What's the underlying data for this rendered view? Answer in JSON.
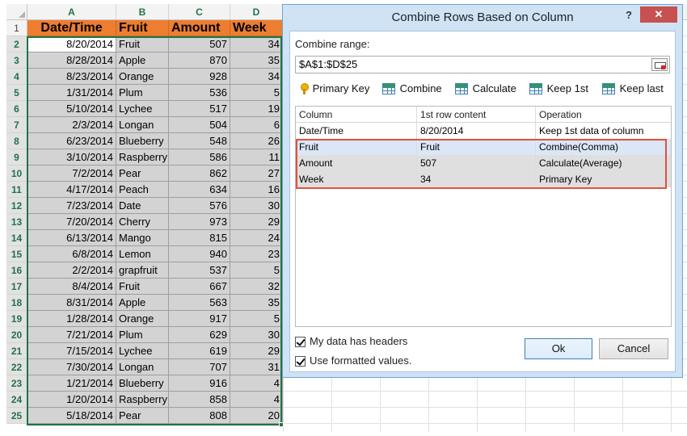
{
  "sheet": {
    "columns": [
      "A",
      "B",
      "C",
      "D"
    ],
    "header_row": [
      "Date/Time",
      "Fruit",
      "Amount",
      "Week"
    ],
    "rows": [
      [
        "8/20/2014",
        "Fruit",
        "507",
        "34"
      ],
      [
        "8/28/2014",
        "Apple",
        "870",
        "35"
      ],
      [
        "8/23/2014",
        "Orange",
        "928",
        "34"
      ],
      [
        "1/31/2014",
        "Plum",
        "536",
        "5"
      ],
      [
        "5/10/2014",
        "Lychee",
        "517",
        "19"
      ],
      [
        "2/3/2014",
        "Longan",
        "504",
        "6"
      ],
      [
        "6/23/2014",
        "Blueberry",
        "548",
        "26"
      ],
      [
        "3/10/2014",
        "Raspberry",
        "586",
        "11"
      ],
      [
        "7/2/2014",
        "Pear",
        "862",
        "27"
      ],
      [
        "4/17/2014",
        "Peach",
        "634",
        "16"
      ],
      [
        "7/23/2014",
        "Date",
        "576",
        "30"
      ],
      [
        "7/20/2014",
        "Cherry",
        "973",
        "29"
      ],
      [
        "6/13/2014",
        "Mango",
        "815",
        "24"
      ],
      [
        "6/8/2014",
        "Lemon",
        "940",
        "23"
      ],
      [
        "2/2/2014",
        "grapfruit",
        "537",
        "5"
      ],
      [
        "8/4/2014",
        "Fruit",
        "667",
        "32"
      ],
      [
        "8/31/2014",
        "Apple",
        "563",
        "35"
      ],
      [
        "1/28/2014",
        "Orange",
        "917",
        "5"
      ],
      [
        "7/21/2014",
        "Plum",
        "629",
        "30"
      ],
      [
        "7/15/2014",
        "Lychee",
        "619",
        "29"
      ],
      [
        "7/30/2014",
        "Longan",
        "707",
        "31"
      ],
      [
        "1/21/2014",
        "Blueberry",
        "916",
        "4"
      ],
      [
        "1/20/2014",
        "Raspberry",
        "858",
        "4"
      ],
      [
        "5/18/2014",
        "Pear",
        "808",
        "20"
      ]
    ],
    "row_numbers": [
      "1",
      "2",
      "3",
      "4",
      "5",
      "6",
      "7",
      "8",
      "9",
      "10",
      "11",
      "12",
      "13",
      "14",
      "15",
      "16",
      "17",
      "18",
      "19",
      "20",
      "21",
      "22",
      "23",
      "24",
      "25"
    ],
    "colors": {
      "header_fill": "#ed7d31",
      "selection_fill": "#d3d3d3",
      "selection_border": "#217346"
    }
  },
  "dialog": {
    "title": "Combine Rows Based on Column",
    "help": "?",
    "close": "✕",
    "range_label": "Combine range:",
    "range_value": "$A$1:$D$25",
    "toolbar": {
      "primary_key": "Primary Key",
      "combine": "Combine",
      "calculate": "Calculate",
      "keep_first": "Keep 1st",
      "keep_last": "Keep last"
    },
    "list": {
      "headers": [
        "Column",
        "1st row content",
        "Operation"
      ],
      "rows": [
        [
          "Date/Time",
          "8/20/2014",
          "Keep 1st data of column"
        ],
        [
          "Fruit",
          "Fruit",
          "Combine(Comma)"
        ],
        [
          "Amount",
          "507",
          "Calculate(Average)"
        ],
        [
          "Week",
          "34",
          "Primary Key"
        ]
      ]
    },
    "headers_check_label": "My data has headers",
    "formatted_check_label": "Use formatted values.",
    "ok": "Ok",
    "cancel": "Cancel",
    "colors": {
      "frame": "#cfe3f5",
      "highlight_border": "#e0523a"
    }
  }
}
